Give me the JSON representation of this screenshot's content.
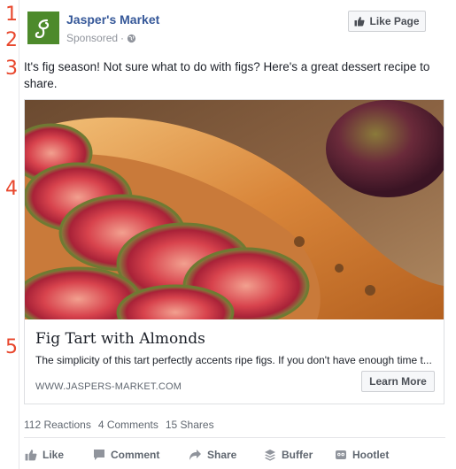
{
  "annotations": [
    "1",
    "2",
    "3",
    "4",
    "5"
  ],
  "post": {
    "page_name": "Jasper's Market",
    "sponsored": "Sponsored",
    "sponsored_dot": "·",
    "like_page_label": "Like Page",
    "text": "It's fig season! Not sure what to do with figs? Here's a great dessert recipe to share."
  },
  "link": {
    "title": "Fig Tart with Almonds",
    "description": "The simplicity of this tart perfectly accents ripe figs. If you don't have enough time t...",
    "domain": "WWW.JASPERS-MARKET.COM",
    "cta_label": "Learn More"
  },
  "stats": {
    "reactions": "112 Reactions",
    "comments": "4 Comments",
    "shares": "15 Shares"
  },
  "actions": [
    {
      "label": "Like",
      "icon": "thumbs-up-icon"
    },
    {
      "label": "Comment",
      "icon": "comment-icon"
    },
    {
      "label": "Share",
      "icon": "share-arrow-icon"
    },
    {
      "label": "Buffer",
      "icon": "buffer-stack-icon"
    },
    {
      "label": "Hootlet",
      "icon": "hootlet-owl-icon"
    }
  ],
  "colors": {
    "link_blue": "#365899",
    "annotation_red": "#e8472d",
    "logo_green": "#4d8a2b",
    "muted_text": "#606770"
  }
}
